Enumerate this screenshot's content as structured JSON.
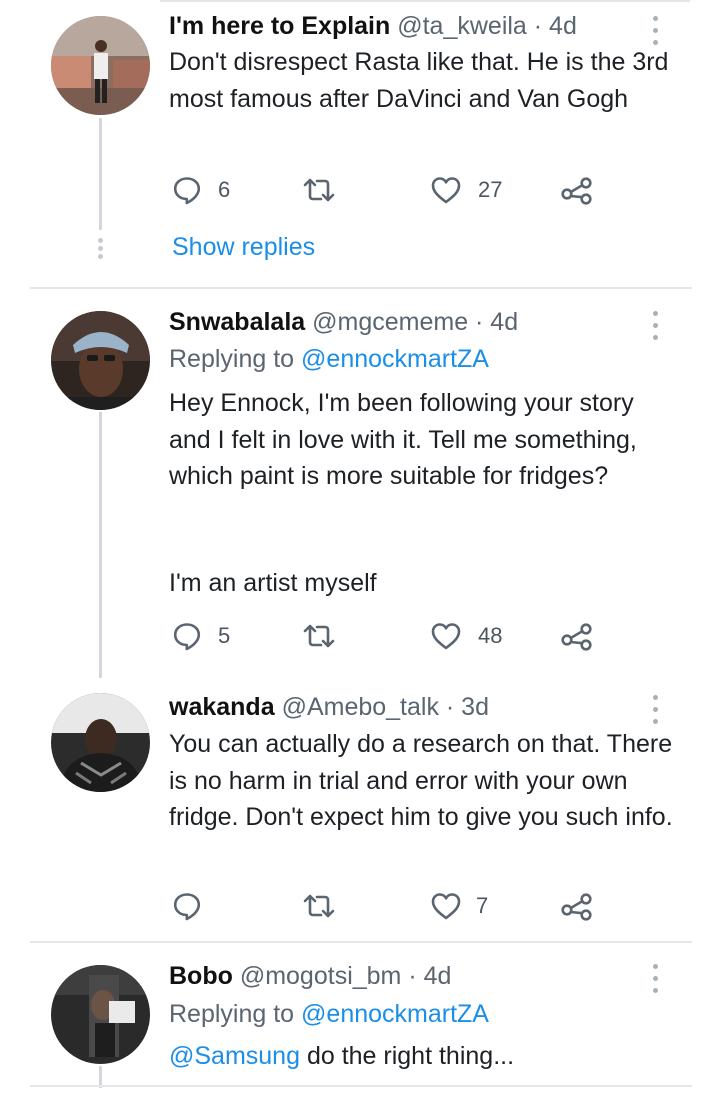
{
  "tweets": [
    {
      "name": "I'm here to Explain",
      "meta": "@ta_kweila · 4d",
      "body": "Don't disrespect Rasta like that. He is the 3rd most famous after DaVinci and Van Gogh",
      "replies": "6",
      "retweets": "",
      "likes": "27"
    },
    {
      "name": "Snwabalala",
      "meta": "@mgcememe · 4d",
      "replying_label": "Replying to",
      "replying_to": "@ennockmartZA",
      "body_line1": "Hey Ennock, I'm been following your story and I felt in love with it. Tell me something, which paint is more suitable for fridges?",
      "body_line2": "I'm an artist myself",
      "replies": "5",
      "retweets": "",
      "likes": "48"
    },
    {
      "name": "wakanda",
      "meta": "@Amebo_talk · 3d",
      "body": "You can actually do a research on that. There is no harm in trial and error with your own fridge. Don't expect him to give you such info.",
      "replies": "",
      "retweets": "",
      "likes": "7"
    },
    {
      "name": "Bobo",
      "meta": "@mogotsi_bm · 4d",
      "replying_label": "Replying to",
      "replying_to": "@ennockmartZA",
      "mention": "@Samsung",
      "body_rest": " do the right thing..."
    }
  ],
  "show_replies_label": "Show replies",
  "icons": {
    "reply": "reply-icon",
    "retweet": "retweet-icon",
    "like": "heart-icon",
    "share": "share-icon",
    "more": "more-vertical-icon"
  },
  "colors": {
    "link": "#1b8ee8",
    "secondary_text": "#5b6570",
    "icon": "#5b6570",
    "divider": "#e6e6e6"
  }
}
